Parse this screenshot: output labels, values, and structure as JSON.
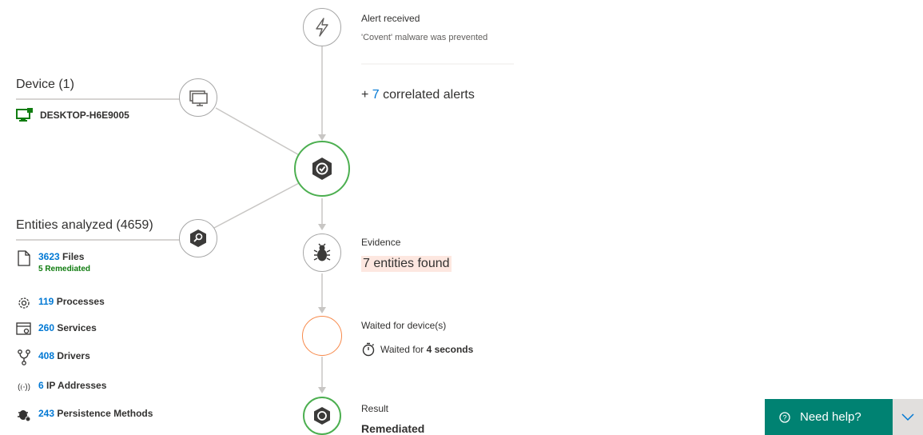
{
  "device_section": {
    "title": "Device (1)",
    "device_name": "DESKTOP-H6E9005"
  },
  "entities_section": {
    "title": "Entities analyzed (4659)",
    "rows": [
      {
        "count": "3623",
        "label": "Files",
        "sublabel": "5 Remediated",
        "icon": "file-icon"
      },
      {
        "count": "119",
        "label": "Processes",
        "icon": "gear-icon"
      },
      {
        "count": "260",
        "label": "Services",
        "icon": "service-icon"
      },
      {
        "count": "408",
        "label": "Drivers",
        "icon": "driver-icon"
      },
      {
        "count": "6",
        "label": "IP Addresses",
        "icon": "ip-address-icon"
      },
      {
        "count": "243",
        "label": "Persistence Methods",
        "icon": "persistence-icon"
      }
    ]
  },
  "timeline": {
    "alert": {
      "title": "Alert received",
      "subtitle": "'Covent' malware was prevented"
    },
    "correlated": {
      "prefix": "+ ",
      "count": "7",
      "suffix": " correlated alerts"
    },
    "evidence": {
      "title": "Evidence",
      "value": "7 entities found"
    },
    "waited": {
      "title": "Waited for device(s)",
      "prefix": "Waited for ",
      "duration": "4 seconds"
    },
    "result": {
      "title": "Result",
      "value": "Remediated"
    }
  },
  "help": {
    "label": "Need help?",
    "icon": "help-circle-icon"
  },
  "colors": {
    "accent_link": "#0078d4",
    "success_green": "#107c10",
    "ring_green": "#4caf50",
    "pending_orange": "#f7894a",
    "evidence_highlight": "#fde7e0",
    "help_bar": "#008272"
  }
}
